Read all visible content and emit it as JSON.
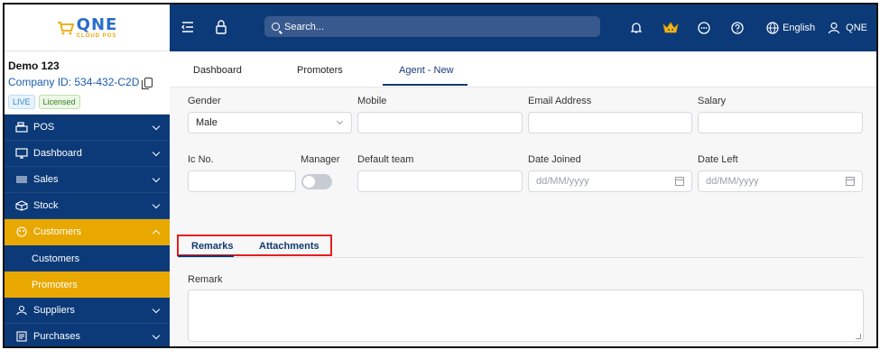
{
  "brand": {
    "logo_main": "QNE",
    "logo_sub": "CLOUD POS"
  },
  "company": {
    "name": "Demo 123",
    "id_text": "Company ID: 534-432-C2D",
    "badges": [
      "LIVE",
      "Licensed"
    ]
  },
  "sidebar": {
    "items": [
      {
        "label": "POS",
        "icon": "register-icon"
      },
      {
        "label": "Dashboard",
        "icon": "monitor-icon"
      },
      {
        "label": "Sales",
        "icon": "barcode-icon"
      },
      {
        "label": "Stock",
        "icon": "box-icon"
      },
      {
        "label": "Customers",
        "icon": "users-icon"
      },
      {
        "label": "Suppliers",
        "icon": "user-icon"
      },
      {
        "label": "Purchases",
        "icon": "document-icon"
      }
    ],
    "sub_items": [
      "Customers",
      "Promoters"
    ]
  },
  "topbar": {
    "search_placeholder": "Search...",
    "language": "English",
    "user": "QNE"
  },
  "tabs": [
    "Dashboard",
    "Promoters",
    "Agent - New"
  ],
  "form": {
    "gender_label": "Gender",
    "gender_value": "Male",
    "mobile_label": "Mobile",
    "email_label": "Email Address",
    "salary_label": "Salary",
    "ic_label": "Ic No.",
    "manager_label": "Manager",
    "default_team_label": "Default team",
    "date_joined_label": "Date Joined",
    "date_left_label": "Date Left",
    "date_placeholder": "dd/MM/yyyy"
  },
  "lower_tabs": [
    "Remarks",
    "Attachments"
  ],
  "remark_label": "Remark",
  "colors": {
    "primary": "#0c3a78",
    "accent": "#e8a800",
    "highlight_box": "#e32020"
  }
}
